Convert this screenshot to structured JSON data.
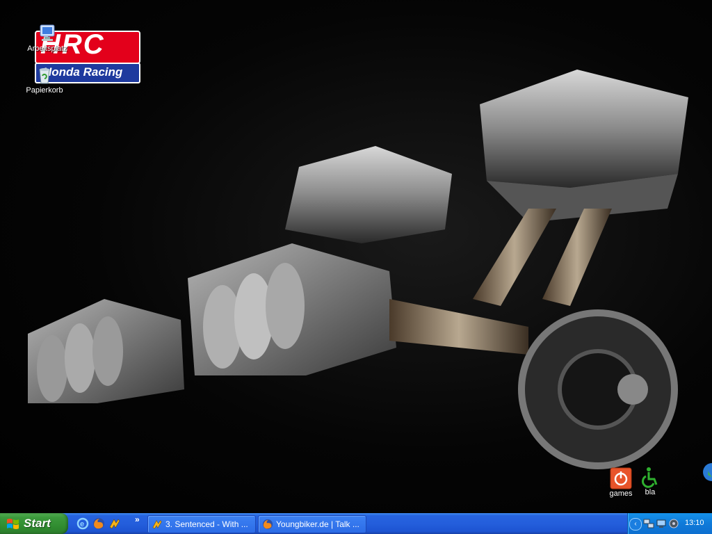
{
  "desktop": {
    "logo": {
      "top": "HRC",
      "bottom": "Honda Racing",
      "brand_red": "#e3001b",
      "brand_blue": "#1e3a9e"
    },
    "icons": [
      {
        "id": "mycomputer",
        "label": "Arbeitsplatz",
        "icon": "my-computer-icon"
      },
      {
        "id": "recycle",
        "label": "Papierkorb",
        "icon": "recycle-bin-icon"
      },
      {
        "id": "games",
        "label": "games",
        "icon": "power-icon"
      },
      {
        "id": "bla",
        "label": "bla",
        "icon": "accessibility-icon"
      }
    ]
  },
  "taskbar": {
    "start_label": "Start",
    "quick_launch": [
      "internet-explorer-icon",
      "firefox-icon",
      "winamp-icon"
    ],
    "overflow": "»",
    "tasks": [
      {
        "label": "3. Sentenced - With ...",
        "icon": "winamp-icon"
      },
      {
        "label": "Youngbiker.de | Talk ...",
        "icon": "firefox-icon"
      }
    ],
    "tray": {
      "collapse": "‹",
      "icons": [
        "network-icon",
        "network-connection-icon",
        "volume-icon"
      ],
      "clock": "13:10"
    }
  },
  "colors": {
    "taskbar_blue": "#245edc",
    "start_green": "#3c9a3c",
    "tray_blue": "#0f7ad9"
  }
}
